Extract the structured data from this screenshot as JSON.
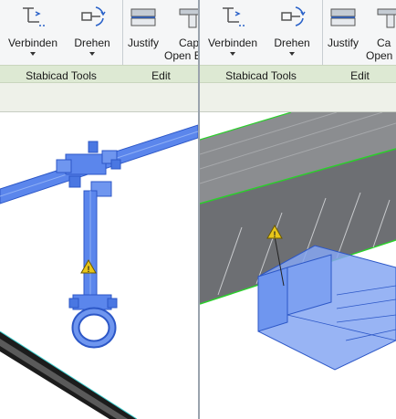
{
  "left_pane": {
    "ribbon": {
      "verbinden_label": "Verbinden",
      "drehen_label": "Drehen",
      "justify_label": "Justify",
      "cap_label": "Cap",
      "cap_sub_label": "Open E",
      "stabicad_group": "Stabicad Tools",
      "edit_group": "Edit"
    }
  },
  "right_pane": {
    "ribbon": {
      "verbinden_label": "Verbinden",
      "drehen_label": "Drehen",
      "justify_label": "Justify",
      "cap_label": "Ca",
      "cap_sub_label": "Open",
      "stabicad_group": "Stabicad Tools",
      "edit_group": "Edit"
    }
  },
  "icons": {
    "verbinden": "connect-pipes-icon",
    "drehen": "rotate-icon",
    "justify": "justify-icon",
    "cap": "cap-open-ends-icon",
    "warning": "warning-icon"
  },
  "colors": {
    "selection_blue": "#3a6fe0",
    "selection_fill": "#6f96ef",
    "warning_yellow": "#e8c61a",
    "edge_green": "#2bcf2b",
    "concrete_gray": "#6d6f73"
  }
}
